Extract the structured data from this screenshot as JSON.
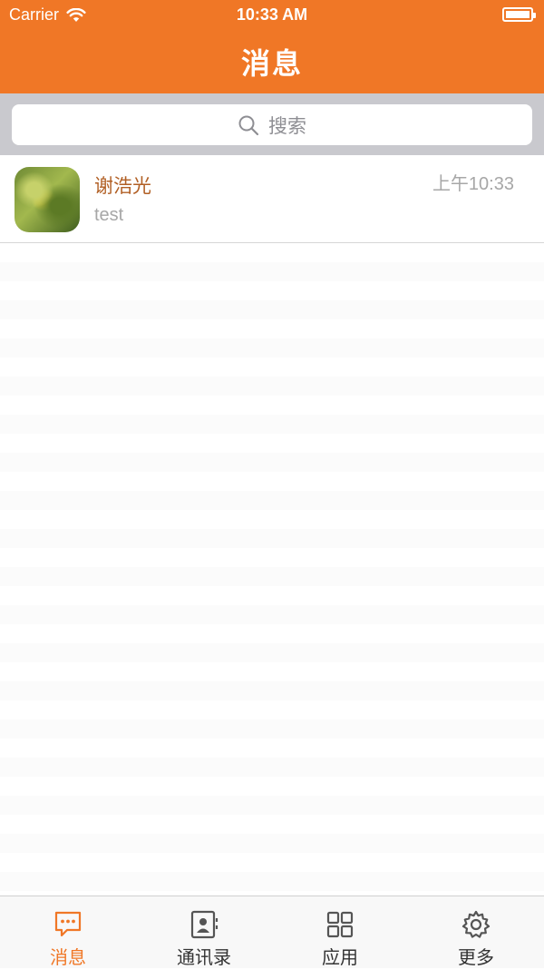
{
  "status_bar": {
    "carrier": "Carrier",
    "time": "10:33 AM"
  },
  "header": {
    "title": "消息"
  },
  "search": {
    "placeholder": "搜索"
  },
  "conversations": [
    {
      "name": "谢浩光",
      "preview": "test",
      "time": "上午10:33"
    }
  ],
  "tabs": [
    {
      "label": "消息",
      "icon": "chat-bubble-icon",
      "active": true
    },
    {
      "label": "通讯录",
      "icon": "contacts-icon",
      "active": false
    },
    {
      "label": "应用",
      "icon": "apps-grid-icon",
      "active": false
    },
    {
      "label": "更多",
      "icon": "gear-icon",
      "active": false
    }
  ],
  "colors": {
    "accent": "#f07726",
    "name": "#b15f24",
    "muted": "#a7a7a7",
    "search_bg": "#c9c9ce"
  }
}
